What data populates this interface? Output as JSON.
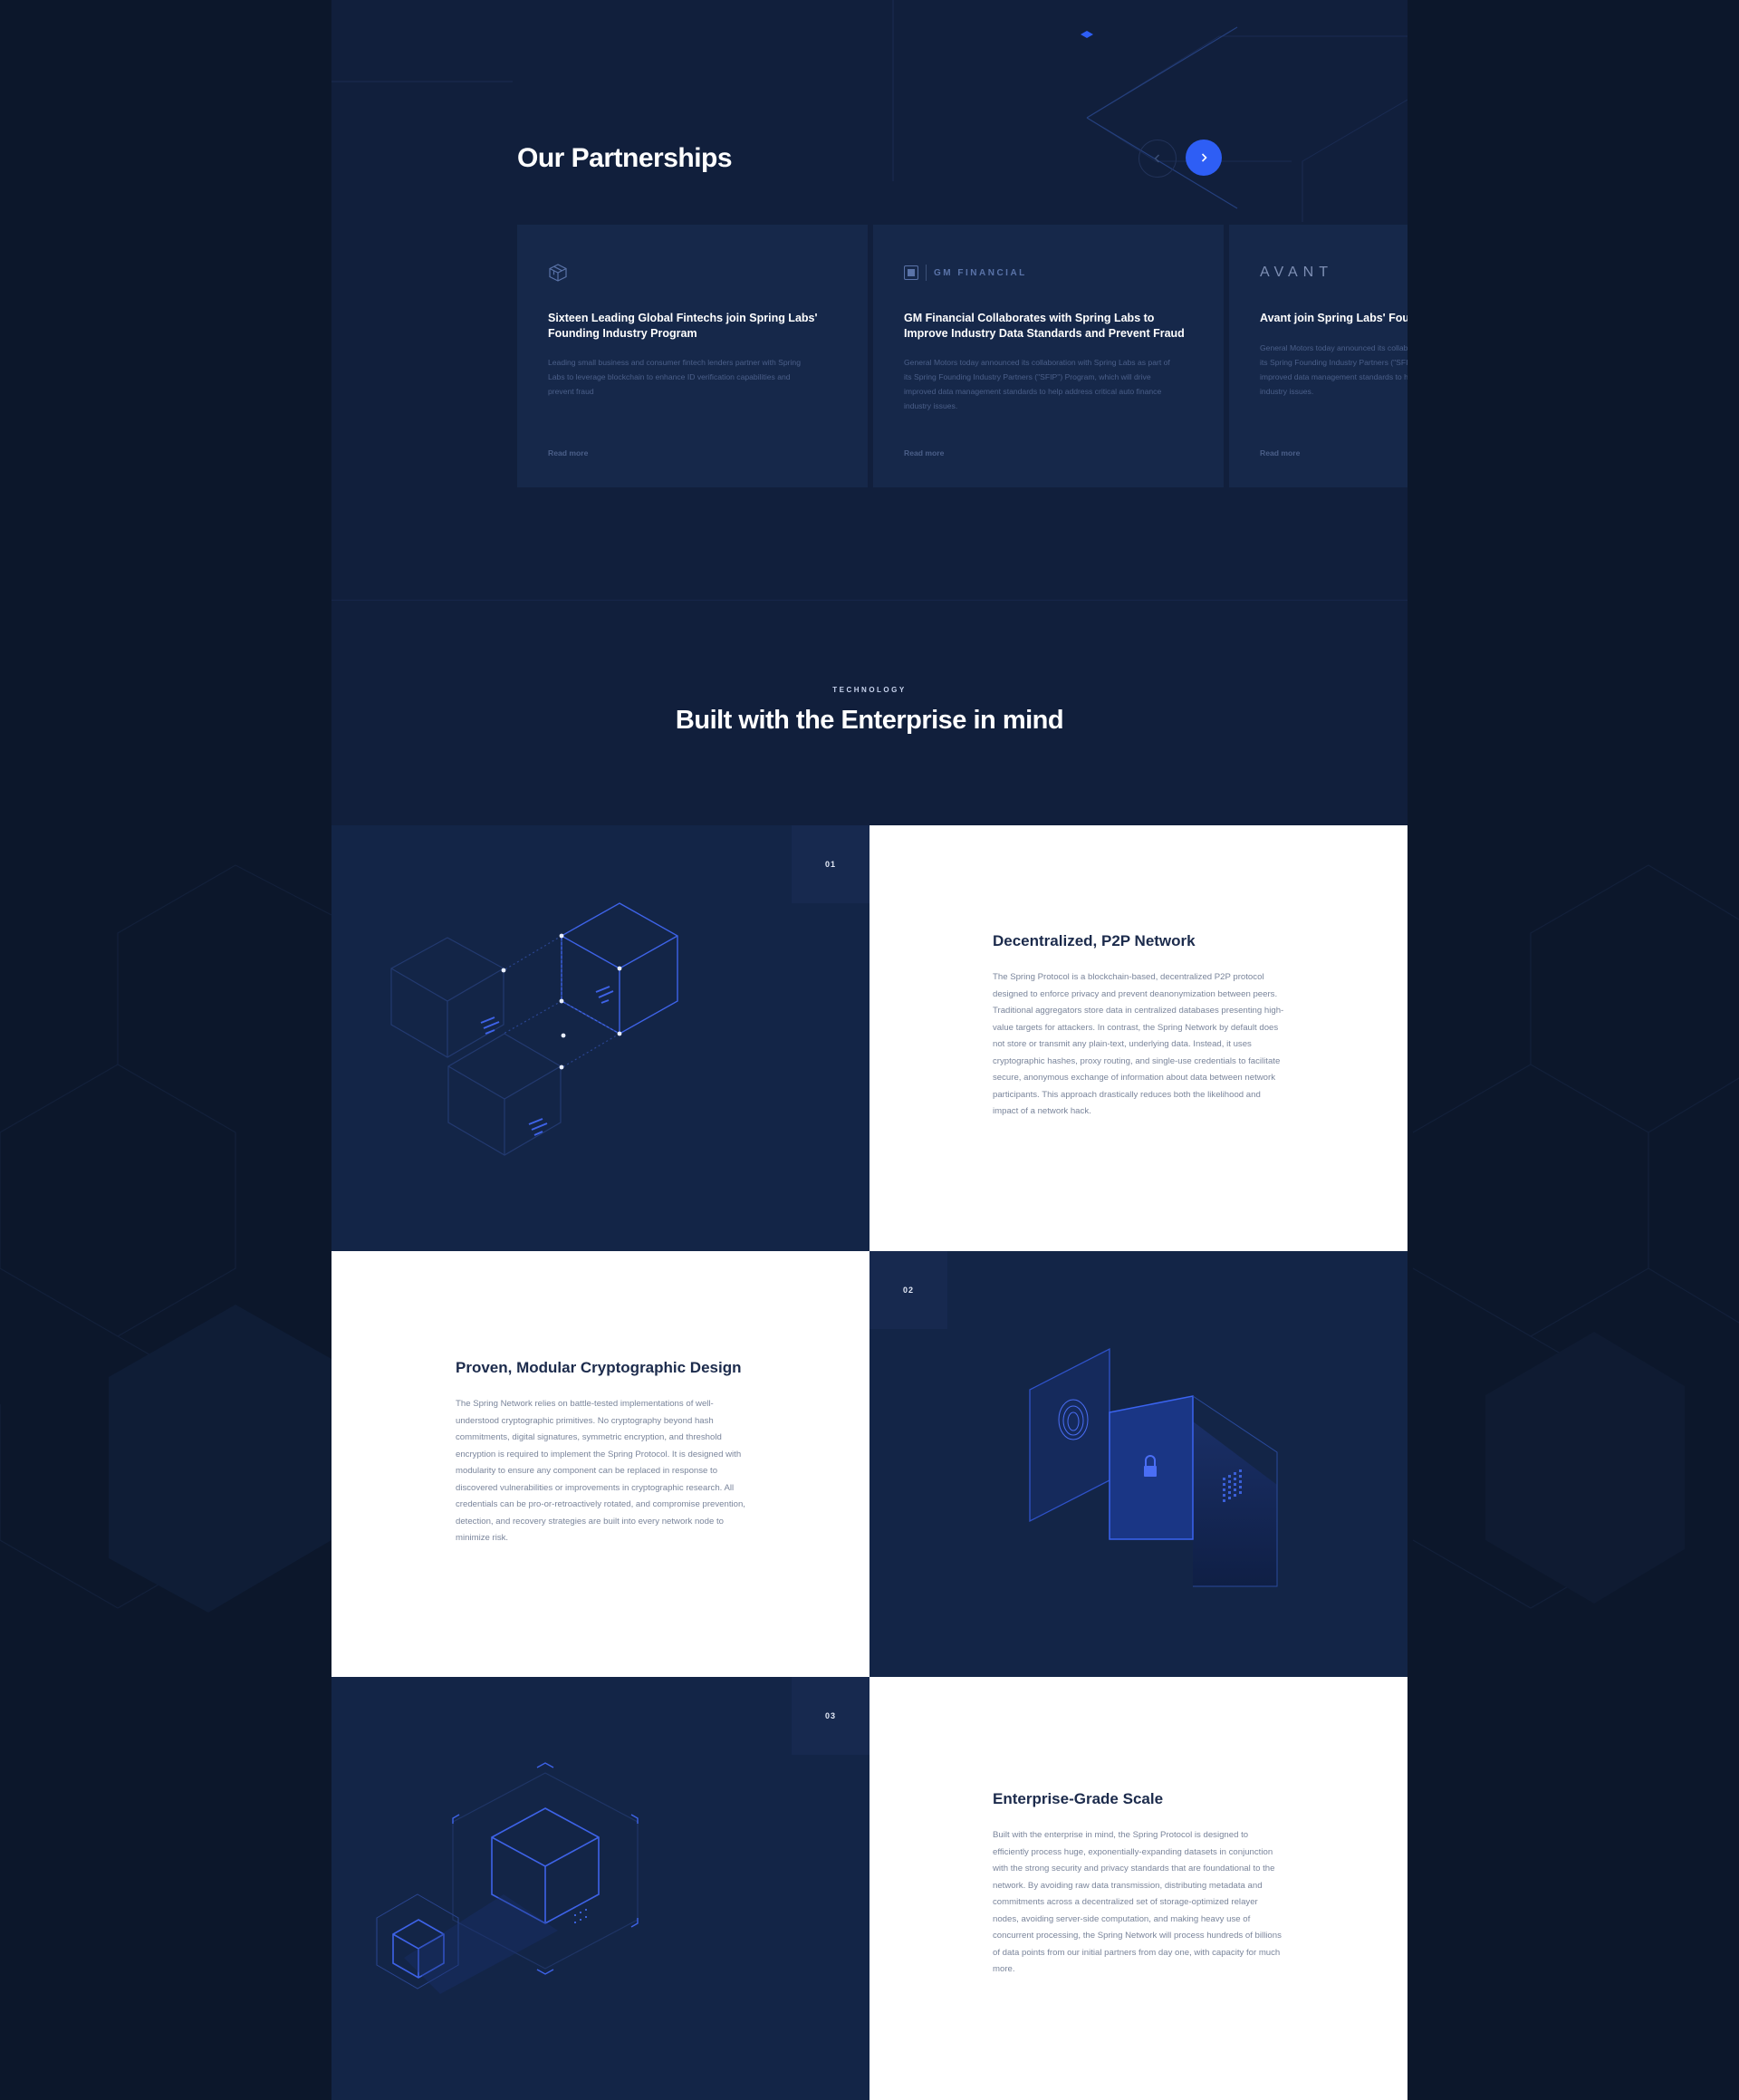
{
  "partnerships": {
    "title": "Our Partnerships",
    "nav": {
      "prev_icon": "chevron-left-icon",
      "next_icon": "chevron-right-icon"
    },
    "cards": [
      {
        "logo": "spring-labs-cube-icon",
        "title": "Sixteen Leading Global Fintechs join Spring Labs' Founding Industry Program",
        "description": "Leading small business and consumer fintech lenders partner with Spring Labs to leverage blockchain to enhance ID verification capabilities and prevent fraud",
        "link": "Read more"
      },
      {
        "logo_text": "GM FINANCIAL",
        "title": "GM Financial Collaborates with Spring Labs to Improve Industry Data Standards and Prevent Fraud",
        "description": "General Motors today announced its collaboration with Spring Labs as part of its Spring Founding Industry Partners (\"SFIP\") Program, which will drive improved data management standards to help address critical auto finance industry issues.",
        "link": "Read more"
      },
      {
        "logo_text": "AVANT",
        "title": "Avant join Spring Labs' Founding Industry Program",
        "description": "General Motors today announced its collaboration with Spring Labs as part of its Spring Founding Industry Partners (\"SFIP\") Program, which will drive improved data management standards to help address critical auto finance industry issues.",
        "link": "Read more"
      }
    ]
  },
  "technology": {
    "eyebrow": "TECHNOLOGY",
    "title": "Built with the Enterprise in mind",
    "features": [
      {
        "number": "01",
        "title": "Decentralized, P2P Network",
        "body": "The Spring Protocol is a blockchain-based, decentralized P2P protocol designed to enforce privacy and prevent deanonymization between peers. Traditional aggregators store data in centralized databases presenting high-value targets for attackers. In contrast, the Spring Network by default does not store or transmit any plain-text, underlying data. Instead, it uses cryptographic hashes, proxy routing, and single-use credentials to facilitate secure, anonymous exchange of information about data between network participants. This approach drastically reduces both the likelihood and impact of a network hack."
      },
      {
        "number": "02",
        "title": "Proven, Modular Cryptographic Design",
        "body": "The Spring Network relies on battle-tested implementations of well-understood cryptographic primitives. No cryptography beyond hash commitments, digital signatures, symmetric encryption, and threshold encryption is required to implement the Spring Protocol. It is designed with modularity to ensure any component can be replaced in response to discovered vulnerabilities or improvements in cryptographic research. All credentials can be pro-or-retroactively rotated, and compromise prevention, detection, and recovery strategies are built into every network node to minimize risk."
      },
      {
        "number": "03",
        "title": "Enterprise-Grade Scale",
        "body": "Built with the enterprise in mind, the Spring Protocol is designed to efficiently process huge, exponentially-expanding datasets in conjunction with the strong security and privacy standards that are foundational to the network. By avoiding raw data transmission, distributing metadata and commitments across a decentralized set of storage-optimized relayer nodes, avoiding server-side computation, and making heavy use of concurrent processing, the Spring Network will process hundreds of billions of data points from our initial partners from day one, with capacity for much more."
      }
    ]
  },
  "colors": {
    "page_bg": "#0c172b",
    "panel_bg": "#111f3c",
    "card_bg": "#16284a",
    "accent": "#2e5ef5",
    "text_dark": "#1c2b4c",
    "text_muted": "#7a859b"
  }
}
